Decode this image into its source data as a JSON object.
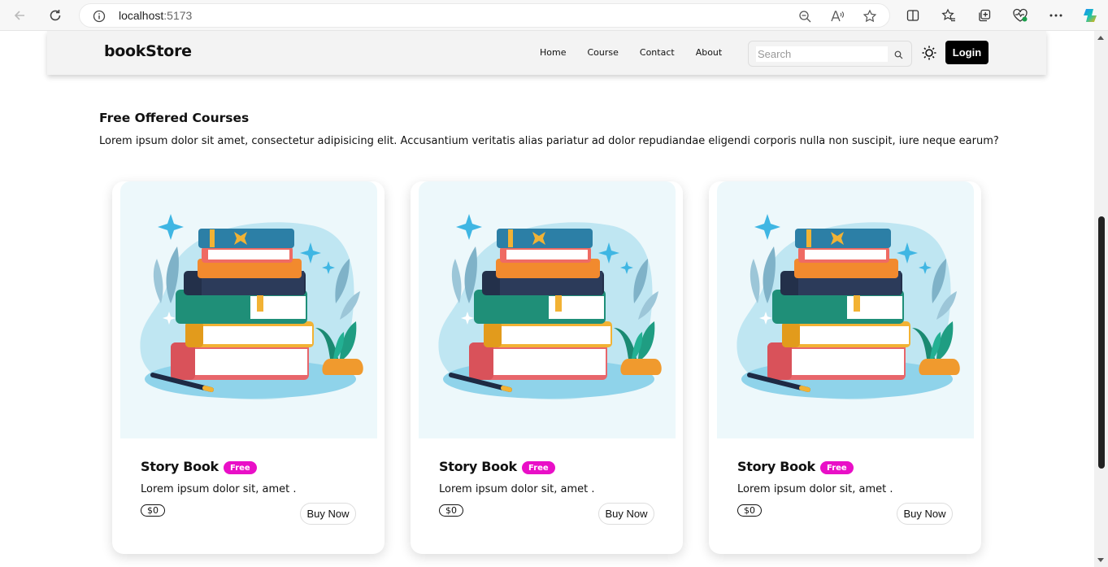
{
  "browser": {
    "url_host": "localhost",
    "url_port": ":5173"
  },
  "navbar": {
    "brand": "bookStore",
    "menu": [
      "Home",
      "Course",
      "Contact",
      "About"
    ],
    "search_placeholder": "Search",
    "login_label": "Login"
  },
  "section": {
    "title": "Free Offered Courses",
    "description": "Lorem ipsum dolor sit amet, consectetur adipisicing elit. Accusantium veritatis alias pariatur ad dolor repudiandae eligendi corporis nulla non suscipit, iure neque earum?"
  },
  "cards": [
    {
      "title": "Story Book",
      "badge": "Free",
      "description": "Lorem ipsum dolor sit, amet .",
      "price": "$0",
      "button": "Buy Now"
    },
    {
      "title": "Story Book",
      "badge": "Free",
      "description": "Lorem ipsum dolor sit, amet .",
      "price": "$0",
      "button": "Buy Now"
    },
    {
      "title": "Story Book",
      "badge": "Free",
      "description": "Lorem ipsum dolor sit, amet .",
      "price": "$0",
      "button": "Buy Now"
    }
  ],
  "colors": {
    "badge": "#e90fc7",
    "login_bg": "#000000",
    "figure_bg": "#edf8fb"
  }
}
